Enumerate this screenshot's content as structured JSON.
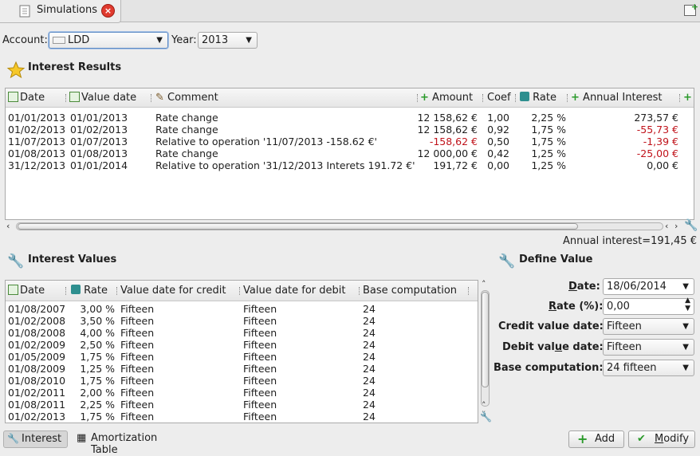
{
  "tab": {
    "title": "Simulations",
    "close_icon": "close-icon",
    "new_tab_icon": "new-tab-icon"
  },
  "filters": {
    "account_label": "Account:",
    "account_value": "LDD",
    "year_label": "Year:",
    "year_value": "2013"
  },
  "interest_results": {
    "title": "Interest Results",
    "columns": [
      "Date",
      "Value date",
      "Comment",
      "Amount",
      "Coef",
      "Rate",
      "Annual Interest"
    ],
    "rows": [
      {
        "date": "01/01/2013",
        "value_date": "01/01/2013",
        "comment": "Rate change",
        "amount": "12 158,62 €",
        "coef": "1,00",
        "rate": "2,25 %",
        "annual": "273,57 €",
        "amount_neg": false,
        "annual_neg": false
      },
      {
        "date": "01/02/2013",
        "value_date": "01/02/2013",
        "comment": "Rate change",
        "amount": "12 158,62 €",
        "coef": "0,92",
        "rate": "1,75 %",
        "annual": "-55,73 €",
        "amount_neg": false,
        "annual_neg": true
      },
      {
        "date": "11/07/2013",
        "value_date": "01/07/2013",
        "comment": "Relative to operation '11/07/2013  -158.62 €'",
        "amount": "-158,62 €",
        "coef": "0,50",
        "rate": "1,75 %",
        "annual": "-1,39 €",
        "amount_neg": true,
        "annual_neg": true
      },
      {
        "date": "01/08/2013",
        "value_date": "01/08/2013",
        "comment": "Rate change",
        "amount": "12 000,00 €",
        "coef": "0,42",
        "rate": "1,25 %",
        "annual": "-25,00 €",
        "amount_neg": false,
        "annual_neg": true
      },
      {
        "date": "31/12/2013",
        "value_date": "01/01/2014",
        "comment": "Relative to operation '31/12/2013 Interets 191.72 €'",
        "amount": "191,72 €",
        "coef": "0,00",
        "rate": "1,25 %",
        "annual": "0,00 €",
        "amount_neg": false,
        "annual_neg": false
      }
    ],
    "summary": "Annual interest=191,45 €"
  },
  "interest_values": {
    "title": "Interest Values",
    "columns": [
      "Date",
      "Rate",
      "Value date for credit",
      "Value date for debit",
      "Base computation"
    ],
    "rows": [
      {
        "date": "01/08/2007",
        "rate": "3,00 %",
        "credit": "Fifteen",
        "debit": "Fifteen",
        "base": "24"
      },
      {
        "date": "01/02/2008",
        "rate": "3,50 %",
        "credit": "Fifteen",
        "debit": "Fifteen",
        "base": "24"
      },
      {
        "date": "01/08/2008",
        "rate": "4,00 %",
        "credit": "Fifteen",
        "debit": "Fifteen",
        "base": "24"
      },
      {
        "date": "01/02/2009",
        "rate": "2,50 %",
        "credit": "Fifteen",
        "debit": "Fifteen",
        "base": "24"
      },
      {
        "date": "01/05/2009",
        "rate": "1,75 %",
        "credit": "Fifteen",
        "debit": "Fifteen",
        "base": "24"
      },
      {
        "date": "01/08/2009",
        "rate": "1,25 %",
        "credit": "Fifteen",
        "debit": "Fifteen",
        "base": "24"
      },
      {
        "date": "01/08/2010",
        "rate": "1,75 %",
        "credit": "Fifteen",
        "debit": "Fifteen",
        "base": "24"
      },
      {
        "date": "01/02/2011",
        "rate": "2,00 %",
        "credit": "Fifteen",
        "debit": "Fifteen",
        "base": "24"
      },
      {
        "date": "01/08/2011",
        "rate": "2,25 %",
        "credit": "Fifteen",
        "debit": "Fifteen",
        "base": "24"
      },
      {
        "date": "01/02/2013",
        "rate": "1,75 %",
        "credit": "Fifteen",
        "debit": "Fifteen",
        "base": "24"
      }
    ]
  },
  "define_value": {
    "title": "Define Value",
    "date_label": "Date:",
    "date_value": "18/06/2014",
    "rate_label": "Rate (%):",
    "rate_value": "0,00",
    "credit_label": "Credit value date:",
    "credit_value": "Fifteen",
    "debit_label": "Debit value date:",
    "debit_value": "Fifteen",
    "base_label": "Base computation:",
    "base_value": "24 fifteen"
  },
  "bottom_tabs": {
    "interest": "Interest",
    "amortization": "Amortization Table"
  },
  "buttons": {
    "add": "Add",
    "modify": "Modify"
  },
  "colors": {
    "negative": "#c0121a",
    "accent_green": "#2a9a2a"
  }
}
